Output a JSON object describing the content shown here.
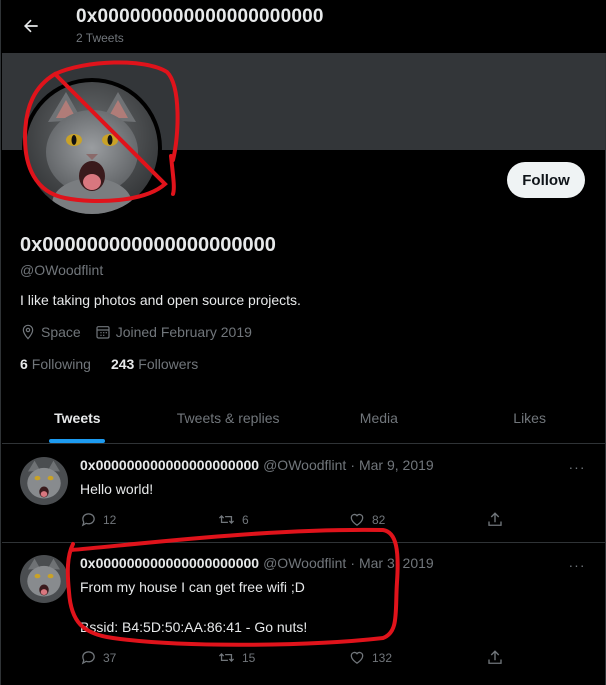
{
  "header": {
    "title": "0x000000000000000000000",
    "subtitle": "2 Tweets"
  },
  "profile": {
    "name": "0x000000000000000000000",
    "handle": "@OWoodflint",
    "bio": "I like taking photos and open source projects.",
    "location": "Space",
    "joined": "Joined February 2019",
    "following_count": "6",
    "following_label": "Following",
    "followers_count": "243",
    "followers_label": "Followers",
    "follow_label": "Follow"
  },
  "tabs": [
    {
      "label": "Tweets",
      "active": true
    },
    {
      "label": "Tweets & replies",
      "active": false
    },
    {
      "label": "Media",
      "active": false
    },
    {
      "label": "Likes",
      "active": false
    }
  ],
  "tweets": [
    {
      "name": "0x000000000000000000000",
      "handle": "@OWoodflint",
      "dot": "·",
      "date": "Mar 9, 2019",
      "more": "···",
      "lines": [
        "Hello world!"
      ],
      "replies": "12",
      "retweets": "6",
      "likes": "82"
    },
    {
      "name": "0x000000000000000000000",
      "handle": "@OWoodflint",
      "dot": "·",
      "date": "Mar 3, 2019",
      "more": "···",
      "lines": [
        "From my house I can get free wifi ;D",
        "",
        "Bssid: B4:5D:50:AA:86:41 - Go nuts!"
      ],
      "replies": "37",
      "retweets": "15",
      "likes": "132"
    }
  ],
  "icons": {
    "back": "back-arrow-icon",
    "location": "location-pin-icon",
    "calendar": "calendar-icon",
    "reply": "reply-icon",
    "retweet": "retweet-icon",
    "like": "heart-icon",
    "share": "share-icon",
    "more": "more-dots-icon"
  },
  "colors": {
    "background": "#000000",
    "banner": "#333639",
    "accent": "#1d9bf0",
    "muted": "#71767b",
    "text": "#e7e9ea",
    "annotation": "#e0131b"
  }
}
